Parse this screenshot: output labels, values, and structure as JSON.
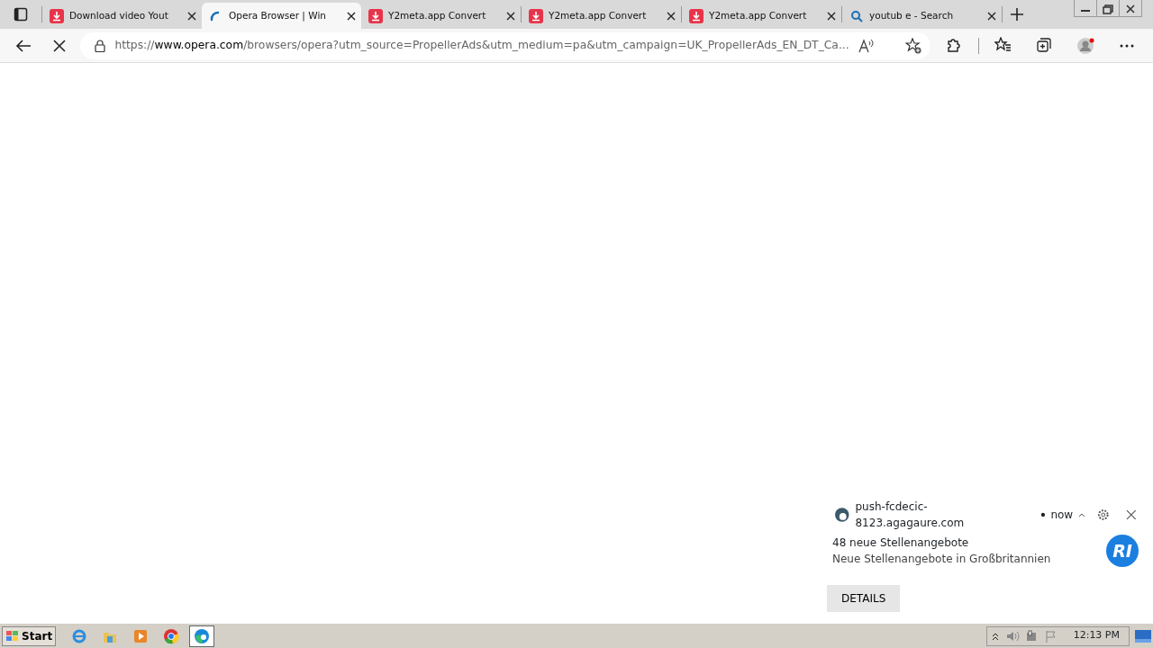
{
  "tabs": [
    {
      "title": "Download video Yout",
      "kind": "download",
      "selected": false
    },
    {
      "title": "Opera Browser | Win",
      "kind": "loading",
      "selected": true
    },
    {
      "title": "Y2meta.app Convert",
      "kind": "download",
      "selected": false
    },
    {
      "title": "Y2meta.app Convert",
      "kind": "download",
      "selected": false
    },
    {
      "title": "Y2meta.app Convert",
      "kind": "download",
      "selected": false
    },
    {
      "title": "youtub e - Search",
      "kind": "search",
      "selected": false
    }
  ],
  "address_bar": {
    "loading": true,
    "scheme": "https://",
    "host": "www.opera.com",
    "path": "/browsers/opera?utm_source=PropellerAds&utm_medium=pa&utm_campaign=UK_PropellerAds_EN_DT_Ca..."
  },
  "notification": {
    "source": "push-fcdecic-8123.agagaure.com",
    "time": "now",
    "title": "48 neue Stellenangebote",
    "body": "Neue Stellenangebote in Großbritannien",
    "avatar_text": "RI",
    "button": "DETAILS"
  },
  "taskbar": {
    "start": "Start",
    "apps": [
      {
        "kind": "ie",
        "selected": false
      },
      {
        "kind": "folder",
        "selected": false
      },
      {
        "kind": "media",
        "selected": false
      },
      {
        "kind": "chrome",
        "selected": false
      },
      {
        "kind": "edge",
        "selected": true
      }
    ],
    "clock": "12:13 PM"
  }
}
